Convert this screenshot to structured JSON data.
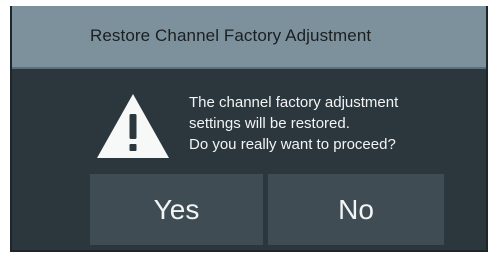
{
  "dialog": {
    "title": "Restore Channel Factory Adjustment",
    "icon": "warning-icon",
    "message_lines": [
      "The channel factory adjustment",
      "settings will be restored.",
      "Do you really want to proceed?"
    ],
    "buttons": {
      "yes_label": "Yes",
      "no_label": "No"
    }
  },
  "colors": {
    "titlebar": "#7d919c",
    "body": "#2b373d",
    "button": "#3f4c53",
    "text_light": "#f2f4f5",
    "text_dark": "#1a1f22"
  }
}
